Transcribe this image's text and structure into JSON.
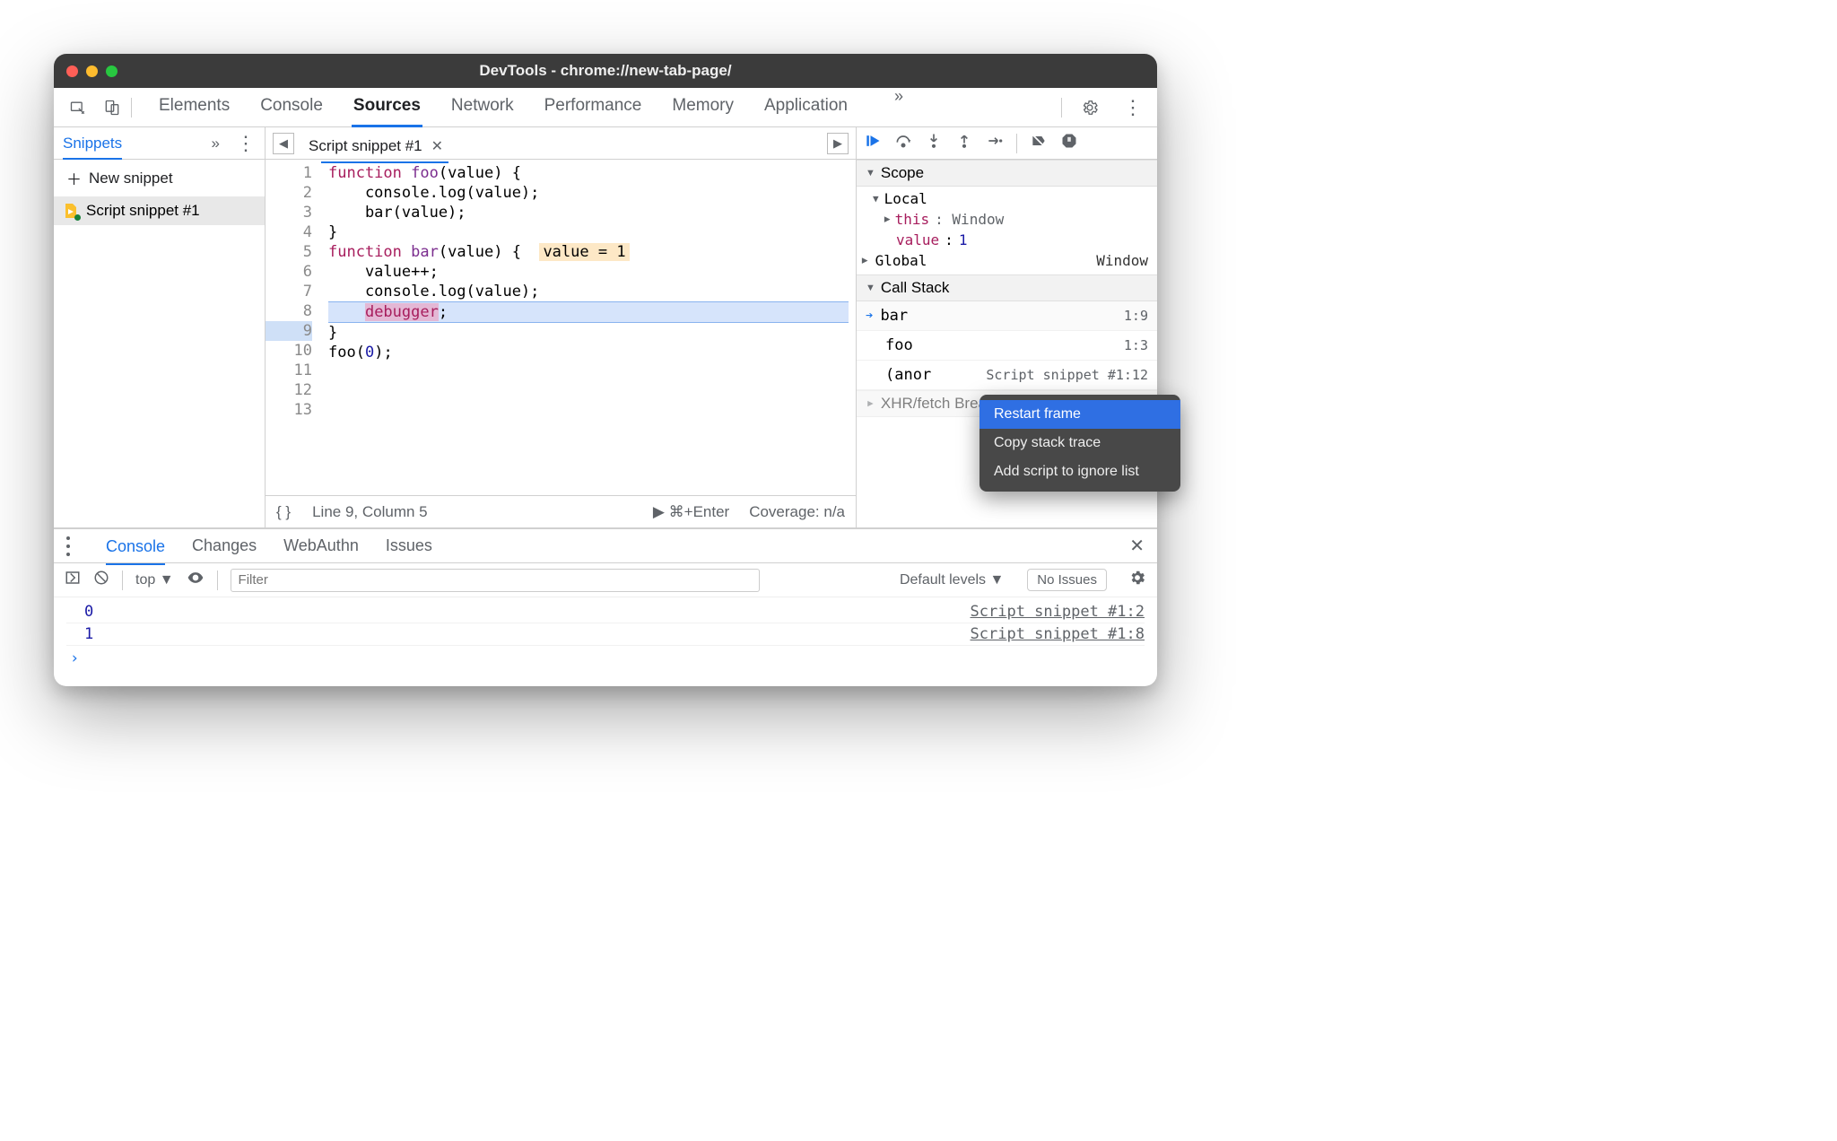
{
  "window": {
    "title": "DevTools - chrome://new-tab-page/"
  },
  "toolbar": {
    "tabs": [
      "Elements",
      "Console",
      "Sources",
      "Network",
      "Performance",
      "Memory",
      "Application"
    ],
    "active": "Sources"
  },
  "left": {
    "tab": "Snippets",
    "new_label": "New snippet",
    "items": [
      {
        "label": "Script snippet #1"
      }
    ]
  },
  "editor": {
    "file_tab": "Script snippet #1",
    "code": {
      "l1a": "function",
      "l1b": " foo",
      "l1c": "(value) {",
      "l2": "    console.log(value);",
      "l3": "    bar(value);",
      "l4": "}",
      "l5": "",
      "l6a": "function",
      "l6b": " bar",
      "l6c": "(value) {  ",
      "l6hl": "value = 1",
      "l7": "    value++;",
      "l8": "    console.log(value);",
      "l9a": "    ",
      "l9b": "debugger",
      "l9c": ";",
      "l10": "}",
      "l11": "",
      "l12a": "foo(",
      "l12b": "0",
      "l12c": ");",
      "l13": ""
    },
    "status": {
      "pos": "Line 9, Column 5",
      "run": "⌘+Enter",
      "coverage": "Coverage: n/a"
    }
  },
  "debug": {
    "scope_h": "Scope",
    "local": "Local",
    "this": "this",
    "this_v": ": Window",
    "value_k": "value",
    "value_v": ": ",
    "value_n": "1",
    "global": "Global",
    "global_v": "Window",
    "callstack_h": "Call Stack",
    "stack": [
      {
        "fn": "bar",
        "loc": "1:9"
      },
      {
        "fn": "foo",
        "loc": "1:3"
      },
      {
        "fn": "(anor",
        "loc": "Script snippet #1:12"
      }
    ],
    "xhr_h": "XHR/fetch Breakpoints"
  },
  "ctx": {
    "items": [
      "Restart frame",
      "Copy stack trace",
      "Add script to ignore list"
    ]
  },
  "drawer": {
    "tabs": [
      "Console",
      "Changes",
      "WebAuthn",
      "Issues"
    ],
    "filter_ph": "Filter",
    "top": "top",
    "levels": "Default levels",
    "noissues": "No Issues",
    "rows": [
      {
        "v": "0",
        "loc": "Script snippet #1:2"
      },
      {
        "v": "1",
        "loc": "Script snippet #1:8"
      }
    ]
  }
}
